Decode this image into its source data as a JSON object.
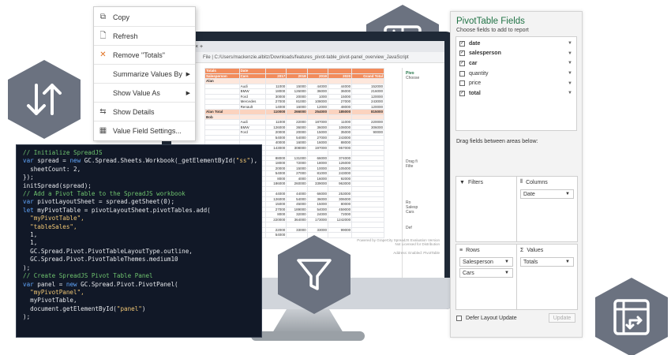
{
  "context_menu": {
    "items": [
      {
        "label": "Copy",
        "icon": "copy-icon"
      },
      {
        "label": "Refresh",
        "icon": "refresh-icon"
      },
      {
        "label": "Remove \"Totals\"",
        "icon": "close-icon"
      },
      {
        "label": "Summarize Values By",
        "icon": ""
      },
      {
        "label": "Show Value As",
        "icon": ""
      },
      {
        "label": "Show Details",
        "icon": "show-details-icon"
      },
      {
        "label": "Value Field Settings...",
        "icon": "settings-icon"
      }
    ]
  },
  "browser": {
    "address": "File | C:/Users/mackenzie.albitz/Downloads/features_pivot-table_pivot-panel_overview_JavaScript"
  },
  "sheet": {
    "header": [
      "Salesperson",
      "Cars",
      "2017",
      "2018",
      "2019",
      "2020",
      "Grand Total"
    ],
    "col_labels": [
      "Totals",
      "Date"
    ],
    "rows": [
      [
        "Alan",
        "",
        "",
        "",
        "",
        "",
        ""
      ],
      [
        "",
        "Audi",
        "11000",
        "15000",
        "44000",
        "44000",
        "152000"
      ],
      [
        "",
        "BMW",
        "18000",
        "126000",
        "36000",
        "36000",
        "216000"
      ],
      [
        "",
        "Ford",
        "30000",
        "20000",
        "1000",
        "15000",
        "120000"
      ],
      [
        "",
        "Mercedes",
        "27000",
        "81000",
        "108000",
        "27000",
        "243000"
      ],
      [
        "",
        "Renault",
        "14000",
        "16000",
        "12000",
        "48000",
        "120000"
      ],
      [
        "Alan Total",
        "",
        "110000",
        "266000",
        "254000",
        "185000",
        "815000"
      ],
      [
        "Bob",
        "",
        "",
        "",
        "",
        "",
        ""
      ],
      [
        "",
        "Audi",
        "11000",
        "22000",
        "187000",
        "11000",
        "220000"
      ],
      [
        "",
        "BMW",
        "126000",
        "36000",
        "36000",
        "108000",
        "306000"
      ],
      [
        "",
        "Ford",
        "20000",
        "20000",
        "15000",
        "35000",
        "90000"
      ],
      [
        "",
        "",
        "54000",
        "54000",
        "27000",
        "243000",
        ""
      ],
      [
        "",
        "",
        "40000",
        "16000",
        "16000",
        "88000",
        ""
      ],
      [
        "",
        "",
        "143000",
        "308000",
        "197000",
        "957000",
        ""
      ],
      [
        "",
        "",
        "",
        "",
        "",
        "",
        ""
      ],
      [
        "",
        "",
        "88000",
        "131000",
        "66000",
        "374000",
        ""
      ],
      [
        "",
        "",
        "18000",
        "72000",
        "18000",
        "126000",
        ""
      ],
      [
        "",
        "",
        "20000",
        "15000",
        "10000",
        "105000",
        ""
      ],
      [
        "",
        "",
        "54000",
        "27000",
        "81000",
        "243000",
        ""
      ],
      [
        "",
        "",
        "8000",
        "4000",
        "16000",
        "92000",
        ""
      ],
      [
        "",
        "",
        "186000",
        "260000",
        "339000",
        "963000",
        ""
      ],
      [
        "",
        "",
        "",
        "",
        "",
        "",
        ""
      ],
      [
        "",
        "",
        "44000",
        "44000",
        "66000",
        "253000",
        ""
      ],
      [
        "",
        "",
        "126000",
        "54000",
        "36000",
        "306000",
        ""
      ],
      [
        "",
        "",
        "15000",
        "45000",
        "15000",
        "80000",
        ""
      ],
      [
        "",
        "",
        "27000",
        "189000",
        "54000",
        "459000",
        ""
      ],
      [
        "",
        "",
        "8000",
        "32000",
        "24000",
        "72000",
        ""
      ],
      [
        "",
        "",
        "220000",
        "364000",
        "173000",
        "1242000",
        ""
      ],
      [
        "",
        "",
        "",
        "",
        "",
        "",
        ""
      ],
      [
        "",
        "",
        "22000",
        "33000",
        "33000",
        "99000",
        ""
      ],
      [
        "",
        "",
        "54000",
        "",
        "",
        "",
        ""
      ]
    ],
    "watermark_1": "Powered by GrapeCity SpreadJS Evaluation Version",
    "watermark_2": "Not Licensed for Distribution",
    "watermark_3": "Address: Enabled: PivotTable"
  },
  "mini_panel": {
    "title": "Pivo",
    "sub": "Choose",
    "drag": "Drag fi",
    "filters": "Filte",
    "rows": "Ro",
    "sales": "Salesp",
    "cars": "Cars",
    "defer": "Def"
  },
  "code": {
    "lines": [
      {
        "parts": [
          {
            "t": "// Initialize SpreadJS",
            "c": "c-com"
          }
        ]
      },
      {
        "parts": [
          {
            "t": "var",
            "c": "c-kw"
          },
          {
            "t": " spread = ",
            "c": ""
          },
          {
            "t": "new",
            "c": "c-kw"
          },
          {
            "t": " GC.Spread.Sheets.Workbook(_getElementById(",
            "c": ""
          },
          {
            "t": "\"ss\"",
            "c": "c-str"
          },
          {
            "t": "), {",
            "c": ""
          }
        ]
      },
      {
        "parts": [
          {
            "t": "  sheetCount: 2,",
            "c": ""
          }
        ]
      },
      {
        "parts": [
          {
            "t": "});",
            "c": ""
          }
        ]
      },
      {
        "parts": [
          {
            "t": "initSpread(spread);",
            "c": ""
          }
        ]
      },
      {
        "parts": [
          {
            "t": "// Add a Pivot Table to the SpreadJS workbook",
            "c": "c-com"
          }
        ]
      },
      {
        "parts": [
          {
            "t": "var",
            "c": "c-kw"
          },
          {
            "t": " pivotLayoutSheet = spread.getSheet(0);",
            "c": ""
          }
        ]
      },
      {
        "parts": [
          {
            "t": "let",
            "c": "c-kw"
          },
          {
            "t": " myPivotTable = pivotLayoutSheet.pivotTables.add(",
            "c": ""
          }
        ]
      },
      {
        "parts": [
          {
            "t": "  \"myPivotTable\",",
            "c": "c-str"
          }
        ]
      },
      {
        "parts": [
          {
            "t": "  \"tableSales\",",
            "c": "c-str"
          }
        ]
      },
      {
        "parts": [
          {
            "t": "  1,",
            "c": ""
          }
        ]
      },
      {
        "parts": [
          {
            "t": "  1,",
            "c": ""
          }
        ]
      },
      {
        "parts": [
          {
            "t": "  GC.Spread.Pivot.PivotTableLayoutType.outline,",
            "c": ""
          }
        ]
      },
      {
        "parts": [
          {
            "t": "  GC.Spread.Pivot.PivotTableThemes.medium10",
            "c": ""
          }
        ]
      },
      {
        "parts": [
          {
            "t": ");",
            "c": ""
          }
        ]
      },
      {
        "parts": [
          {
            "t": "// Create SpreadJS Pivot Table Panel",
            "c": "c-com"
          }
        ]
      },
      {
        "parts": [
          {
            "t": "var",
            "c": "c-kw"
          },
          {
            "t": " panel = ",
            "c": ""
          },
          {
            "t": "new",
            "c": "c-kw"
          },
          {
            "t": " GC.Spread.Pivot.PivotPanel(",
            "c": ""
          }
        ]
      },
      {
        "parts": [
          {
            "t": "  \"myPivotPanel\",",
            "c": "c-str"
          }
        ]
      },
      {
        "parts": [
          {
            "t": "  myPivotTable,",
            "c": ""
          }
        ]
      },
      {
        "parts": [
          {
            "t": "  document.getElementById(",
            "c": ""
          },
          {
            "t": "\"panel\"",
            "c": "c-str"
          },
          {
            "t": ")",
            "c": ""
          }
        ]
      },
      {
        "parts": [
          {
            "t": ");",
            "c": ""
          }
        ]
      }
    ]
  },
  "pivot_panel": {
    "title": "PivotTable Fields",
    "subtitle": "Choose fields to add to report",
    "fields": [
      {
        "label": "date",
        "checked": true,
        "bold": true
      },
      {
        "label": "salesperson",
        "checked": true,
        "bold": true
      },
      {
        "label": "car",
        "checked": true,
        "bold": true
      },
      {
        "label": "quantity",
        "checked": false,
        "bold": false
      },
      {
        "label": "price",
        "checked": false,
        "bold": false
      },
      {
        "label": "total",
        "checked": true,
        "bold": true
      }
    ],
    "drag_label": "Drag fields between areas below:",
    "filters_label": "Filters",
    "columns_label": "Columns",
    "columns_items": [
      "Date"
    ],
    "rows_label": "Rows",
    "rows_items": [
      "Salesperson",
      "Cars"
    ],
    "values_label": "Values",
    "values_items": [
      "Totals"
    ],
    "defer_label": "Defer Layout Update",
    "update_label": "Update"
  },
  "colors": {
    "hex_icon": "#6b7280",
    "pivot_title": "#217346",
    "header_orange": "#f28b5b"
  }
}
